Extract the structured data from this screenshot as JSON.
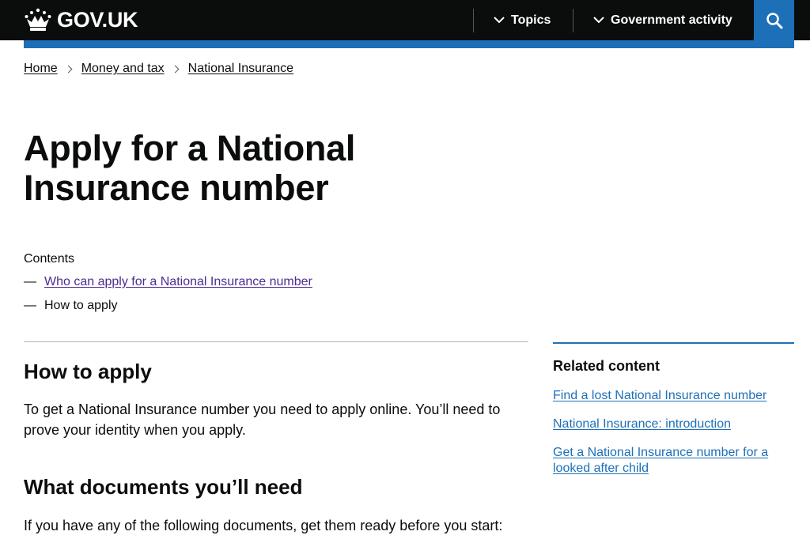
{
  "header": {
    "logo_text": "GOV.UK",
    "nav": [
      {
        "label": "Topics"
      },
      {
        "label": "Government activity"
      }
    ]
  },
  "breadcrumb": [
    {
      "label": "Home"
    },
    {
      "label": "Money and tax"
    },
    {
      "label": "National Insurance"
    }
  ],
  "page": {
    "title": "Apply for a National Insurance number"
  },
  "contents": {
    "label": "Contents",
    "dash": "—",
    "items": [
      {
        "label": "Who can apply for a National Insurance number",
        "is_link": true
      },
      {
        "label": "How to apply",
        "is_link": false
      }
    ]
  },
  "main": {
    "section1_heading": "How to apply",
    "section1_text": "To get a National Insurance number you need to apply online. You’ll need to prove your identity when you apply.",
    "section2_heading": "What documents you’ll need",
    "section2_text": "If you have any of the following documents, get them ready before you start:"
  },
  "related": {
    "title": "Related content",
    "items": [
      {
        "label": "Find a lost National Insurance number"
      },
      {
        "label": "National Insurance: introduction"
      },
      {
        "label": "Get a National Insurance number for a looked after child"
      }
    ]
  },
  "colors": {
    "header_bg": "#0b0c0c",
    "brand_blue": "#1d70b8",
    "visited_link": "#4c2c92",
    "text": "#0b0c0c"
  },
  "icons": {
    "logo": "crown-icon",
    "nav_chevron": "chevron-down-icon",
    "search": "search-icon"
  }
}
